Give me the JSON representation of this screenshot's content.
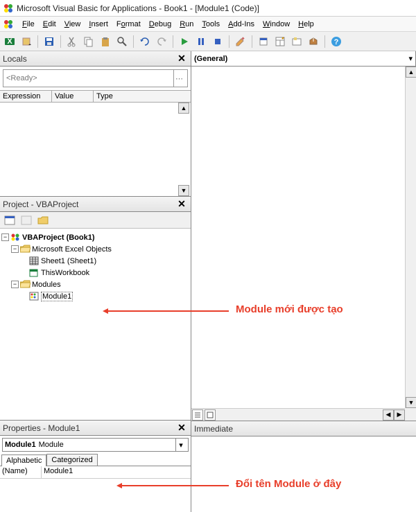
{
  "title": "Microsoft Visual Basic for Applications - Book1 - [Module1 (Code)]",
  "menu": {
    "file": "File",
    "edit": "Edit",
    "view": "View",
    "insert": "Insert",
    "format": "Format",
    "debug": "Debug",
    "run": "Run",
    "tools": "Tools",
    "addins": "Add-Ins",
    "window": "Window",
    "help": "Help"
  },
  "locals": {
    "title": "Locals",
    "ready": "<Ready>",
    "cols": {
      "expression": "Expression",
      "value": "Value",
      "type": "Type"
    }
  },
  "project": {
    "title": "Project - VBAProject",
    "root": "VBAProject (Book1)",
    "excelObjects": "Microsoft Excel Objects",
    "sheet1": "Sheet1 (Sheet1)",
    "thisWorkbook": "ThisWorkbook",
    "modulesFolder": "Modules",
    "module1": "Module1"
  },
  "properties": {
    "title": "Properties - Module1",
    "comboName": "Module1",
    "comboType": "Module",
    "tabs": {
      "alphabetic": "Alphabetic",
      "categorized": "Categorized"
    },
    "rows": [
      {
        "key": "(Name)",
        "value": "Module1"
      }
    ]
  },
  "code": {
    "leftCombo": "(General)"
  },
  "immediate": {
    "title": "Immediate"
  },
  "annotations": {
    "a1": "Module mới được tạo",
    "a2": "Đổi tên Module ở đây"
  }
}
